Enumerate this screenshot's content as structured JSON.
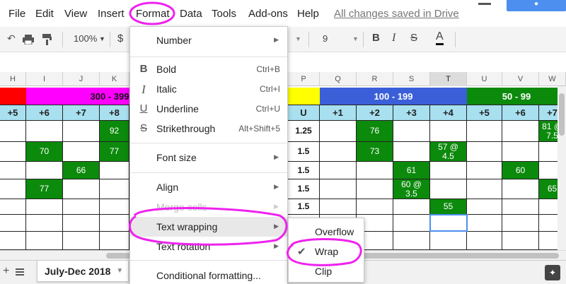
{
  "menubar": {
    "items": [
      "File",
      "Edit",
      "View",
      "Insert",
      "Format",
      "Data",
      "Tools",
      "Add-ons",
      "Help"
    ],
    "saved_status": "All changes saved in Drive"
  },
  "toolbar": {
    "zoom": "100%",
    "currency": "$",
    "font_size": "9"
  },
  "columns": [
    "H",
    "I",
    "J",
    "K",
    "P",
    "Q",
    "R",
    "S",
    "T",
    "U",
    "V",
    "W"
  ],
  "bands": {
    "left": "300 - 399",
    "mid": "100 - 199",
    "right": "50 - 99"
  },
  "header_row": [
    "+5",
    "+6",
    "+7",
    "+8",
    "U",
    "+1",
    "+2",
    "+3",
    "+4",
    "+5",
    "+6",
    "+7"
  ],
  "cells": {
    "k1": "92",
    "i2": "70",
    "k2": "77",
    "j3": "66",
    "i4": "77",
    "p1": "1.25",
    "p2": "1.5",
    "p3": "1.5",
    "p4": "1.5",
    "p5": "1.5",
    "r1": "76",
    "r2": "73",
    "s3": "61",
    "s4a": "60 @",
    "s4b": "3.5",
    "t2a": "57 @",
    "t2b": "4.5",
    "t5": "55",
    "v3": "60",
    "w1a": "81 @",
    "w1b": "7.5",
    "w4": "65"
  },
  "format_menu": {
    "number": "Number",
    "bold": "Bold",
    "bold_sc": "Ctrl+B",
    "italic": "Italic",
    "italic_sc": "Ctrl+I",
    "underline": "Underline",
    "underline_sc": "Ctrl+U",
    "strike": "Strikethrough",
    "strike_sc": "Alt+Shift+5",
    "font_size": "Font size",
    "align": "Align",
    "merge": "Merge cells",
    "wrapping": "Text wrapping",
    "rotation": "Text rotation",
    "conditional": "Conditional formatting..."
  },
  "wrap_submenu": {
    "overflow": "Overflow",
    "wrap": "Wrap",
    "clip": "Clip"
  },
  "sheet_tab": "July-Dec 2018",
  "colors": {
    "green": "#0c8a0c",
    "magenta": "#ff00ff",
    "red": "#ff0000",
    "yellow": "#ffff00",
    "blue": "#3a5fd8",
    "band_green": "#0c8a0c",
    "header_cyan": "#a8e0f0",
    "annotation": "#ee22ee"
  },
  "icons": [
    "print-icon",
    "paint-format-icon",
    "bold-icon",
    "italic-icon",
    "underline-icon",
    "strikethrough-icon",
    "text-color-icon",
    "checkmark-icon",
    "sheet-list-icon",
    "explore-icon"
  ]
}
